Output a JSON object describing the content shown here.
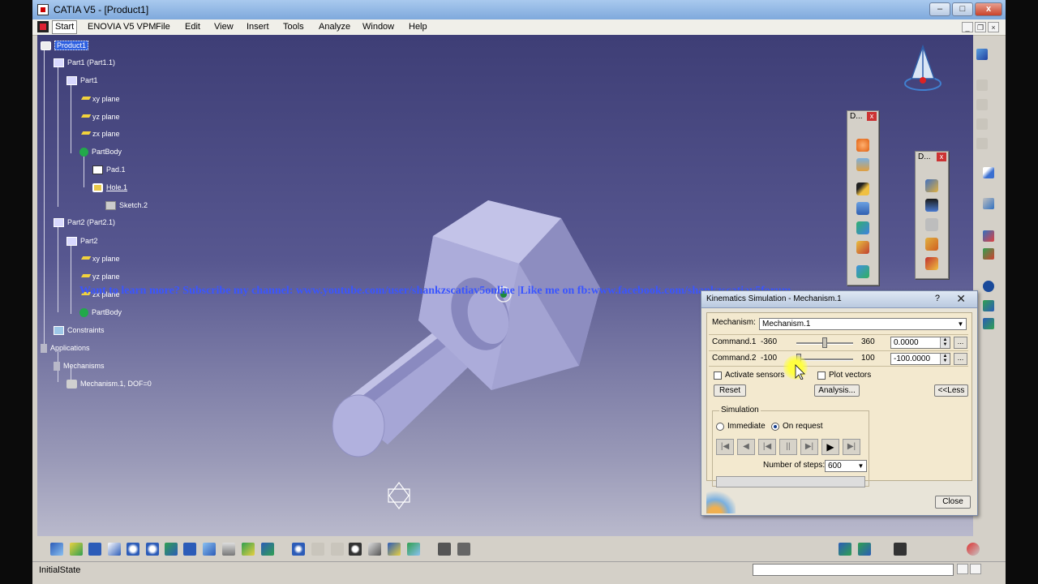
{
  "window": {
    "title": "CATIA V5 - [Product1]",
    "controls": {
      "minimize": "–",
      "maximize": "□",
      "close": "x"
    },
    "mdi_controls": {
      "minimize": "_",
      "restore": "❐",
      "close": "×"
    }
  },
  "menu": {
    "items": [
      "Start",
      "ENOVIA V5 VPM",
      "File",
      "Edit",
      "View",
      "Insert",
      "Tools",
      "Analyze",
      "Window",
      "Help"
    ]
  },
  "tree": {
    "nodes": [
      {
        "label": "Product1",
        "icon": "product-icon"
      },
      {
        "label": "Part1 (Part1.1)",
        "icon": "part-instance-icon"
      },
      {
        "label": "Part1",
        "icon": "part-icon"
      },
      {
        "label": "xy plane",
        "icon": "plane-icon"
      },
      {
        "label": "yz plane",
        "icon": "plane-icon"
      },
      {
        "label": "zx plane",
        "icon": "plane-icon"
      },
      {
        "label": "PartBody",
        "icon": "partbody-icon"
      },
      {
        "label": "Pad.1",
        "icon": "pad-icon"
      },
      {
        "label": "Hole.1",
        "icon": "hole-icon"
      },
      {
        "label": "Sketch.2",
        "icon": "sketch-icon"
      },
      {
        "label": "Part2 (Part2.1)",
        "icon": "part-instance-icon"
      },
      {
        "label": "Part2",
        "icon": "part-icon"
      },
      {
        "label": "xy plane",
        "icon": "plane-icon"
      },
      {
        "label": "yz plane",
        "icon": "plane-icon"
      },
      {
        "label": "zx plane",
        "icon": "plane-icon"
      },
      {
        "label": "PartBody",
        "icon": "partbody-icon"
      },
      {
        "label": "Constraints",
        "icon": "constraints-icon"
      },
      {
        "label": "Applications",
        "icon": "applications-icon"
      },
      {
        "label": "Mechanisms",
        "icon": "mechanisms-icon"
      },
      {
        "label": "Mechanism.1, DOF=0",
        "icon": "mechanism-icon"
      }
    ]
  },
  "overlay": {
    "text": "Want to learn more? Subscribe my channel: www.youtube.com/user/shankzscatiav5online |Like me on fb:www.facebook.com/shankzscatiav5forum"
  },
  "toolbars": {
    "dmu1_title": "D...",
    "dmu2_title": "D..."
  },
  "dialog": {
    "title": "Kinematics Simulation - Mechanism.1",
    "help": "?",
    "close_x": "✕",
    "mechanism_label": "Mechanism:",
    "mechanism_value": "Mechanism.1",
    "commands": [
      {
        "name": "Command.1",
        "min": "-360",
        "max": "360",
        "value": "0.0000",
        "position": 0.5
      },
      {
        "name": "Command.2",
        "min": "-100",
        "max": "100",
        "value": "-100.0000",
        "position": 0.0
      }
    ],
    "more": "...",
    "activate_sensors": "Activate sensors",
    "plot_vectors": "Plot vectors",
    "reset": "Reset",
    "analysis": "Analysis...",
    "less": "<<Less",
    "simulation_group": "Simulation",
    "immediate": "Immediate",
    "on_request": "On request",
    "steps_label": "Number of steps:",
    "steps_value": "600",
    "close_button": "Close"
  },
  "status": {
    "text": "InitialState"
  },
  "colors": {
    "viewport_top": "#3e3e76",
    "viewport_bottom": "#b9b9cc",
    "tree_selection": "#2d5fe0",
    "overlay_text": "#3a55ff",
    "part_color": "#a7a7d8"
  }
}
